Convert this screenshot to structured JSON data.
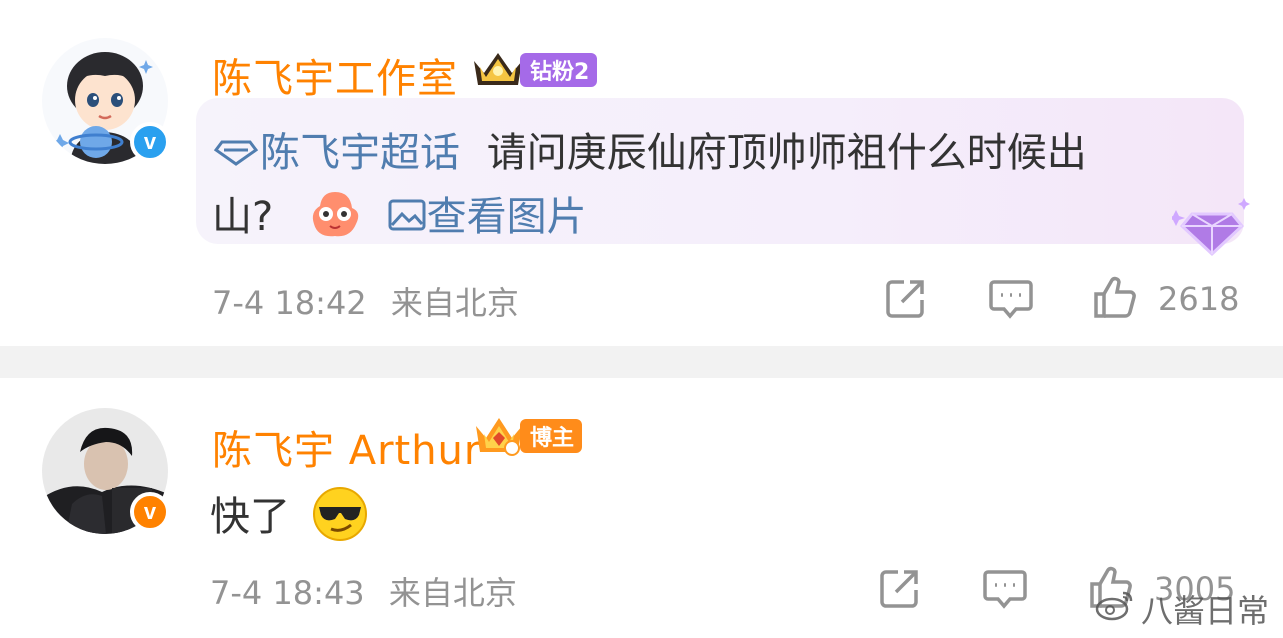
{
  "comments": [
    {
      "username": "陈飞宇工作室",
      "fan_badge": "钻粉2",
      "topic": "陈飞宇超话",
      "text_line1": "请问庚辰仙府顶帅师祖什么时候出",
      "text_line2": "山?",
      "view_image": "查看图片",
      "time": "7-4 18:42",
      "location": "来自北京",
      "likes": "2618",
      "colors": {
        "name": "#ff8200",
        "verified": "#2aa0ef",
        "badge": "#a56ae8"
      }
    },
    {
      "username": "陈飞宇 Arthur",
      "fan_badge": "博主",
      "text": "快了",
      "time": "7-4 18:43",
      "location": "来自北京",
      "likes": "3005",
      "colors": {
        "name": "#ff8200",
        "verified": "#ff8200",
        "badge": "#ff8c1a"
      }
    }
  ],
  "watermark": "八酱日常",
  "icons": {
    "share": "share-icon",
    "comment": "comment-icon",
    "like": "like-icon",
    "crown": "crown-icon",
    "topic": "diamond-topic-icon",
    "image": "image-icon",
    "emoji_cute": "cute-emoji-icon",
    "emoji_cool": "sunglasses-emoji-icon"
  }
}
